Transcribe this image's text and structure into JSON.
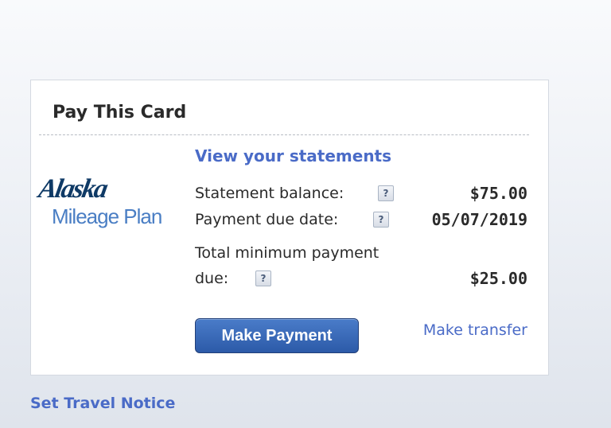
{
  "card": {
    "title": "Pay This Card",
    "logo": {
      "line1": "Alaska",
      "line2": "Mileage Plan"
    },
    "view_statements": "View your statements",
    "rows": {
      "statement_balance": {
        "label": "Statement balance:",
        "help": "?",
        "value": "$75.00"
      },
      "payment_due_date": {
        "label": "Payment due date:",
        "help": "?",
        "value": "05/07/2019"
      },
      "minimum_payment": {
        "label_line1": "Total minimum payment",
        "label_line2": "due:",
        "help": "?",
        "value": "$25.00"
      }
    },
    "make_payment_label": "Make Payment",
    "make_transfer_label": "Make transfer"
  },
  "travel_notice_label": "Set Travel Notice",
  "colors": {
    "link": "#4a6bc7",
    "button": "#2c5aa8",
    "logo_dark": "#0f3a66",
    "logo_light": "#4a7ec4"
  }
}
